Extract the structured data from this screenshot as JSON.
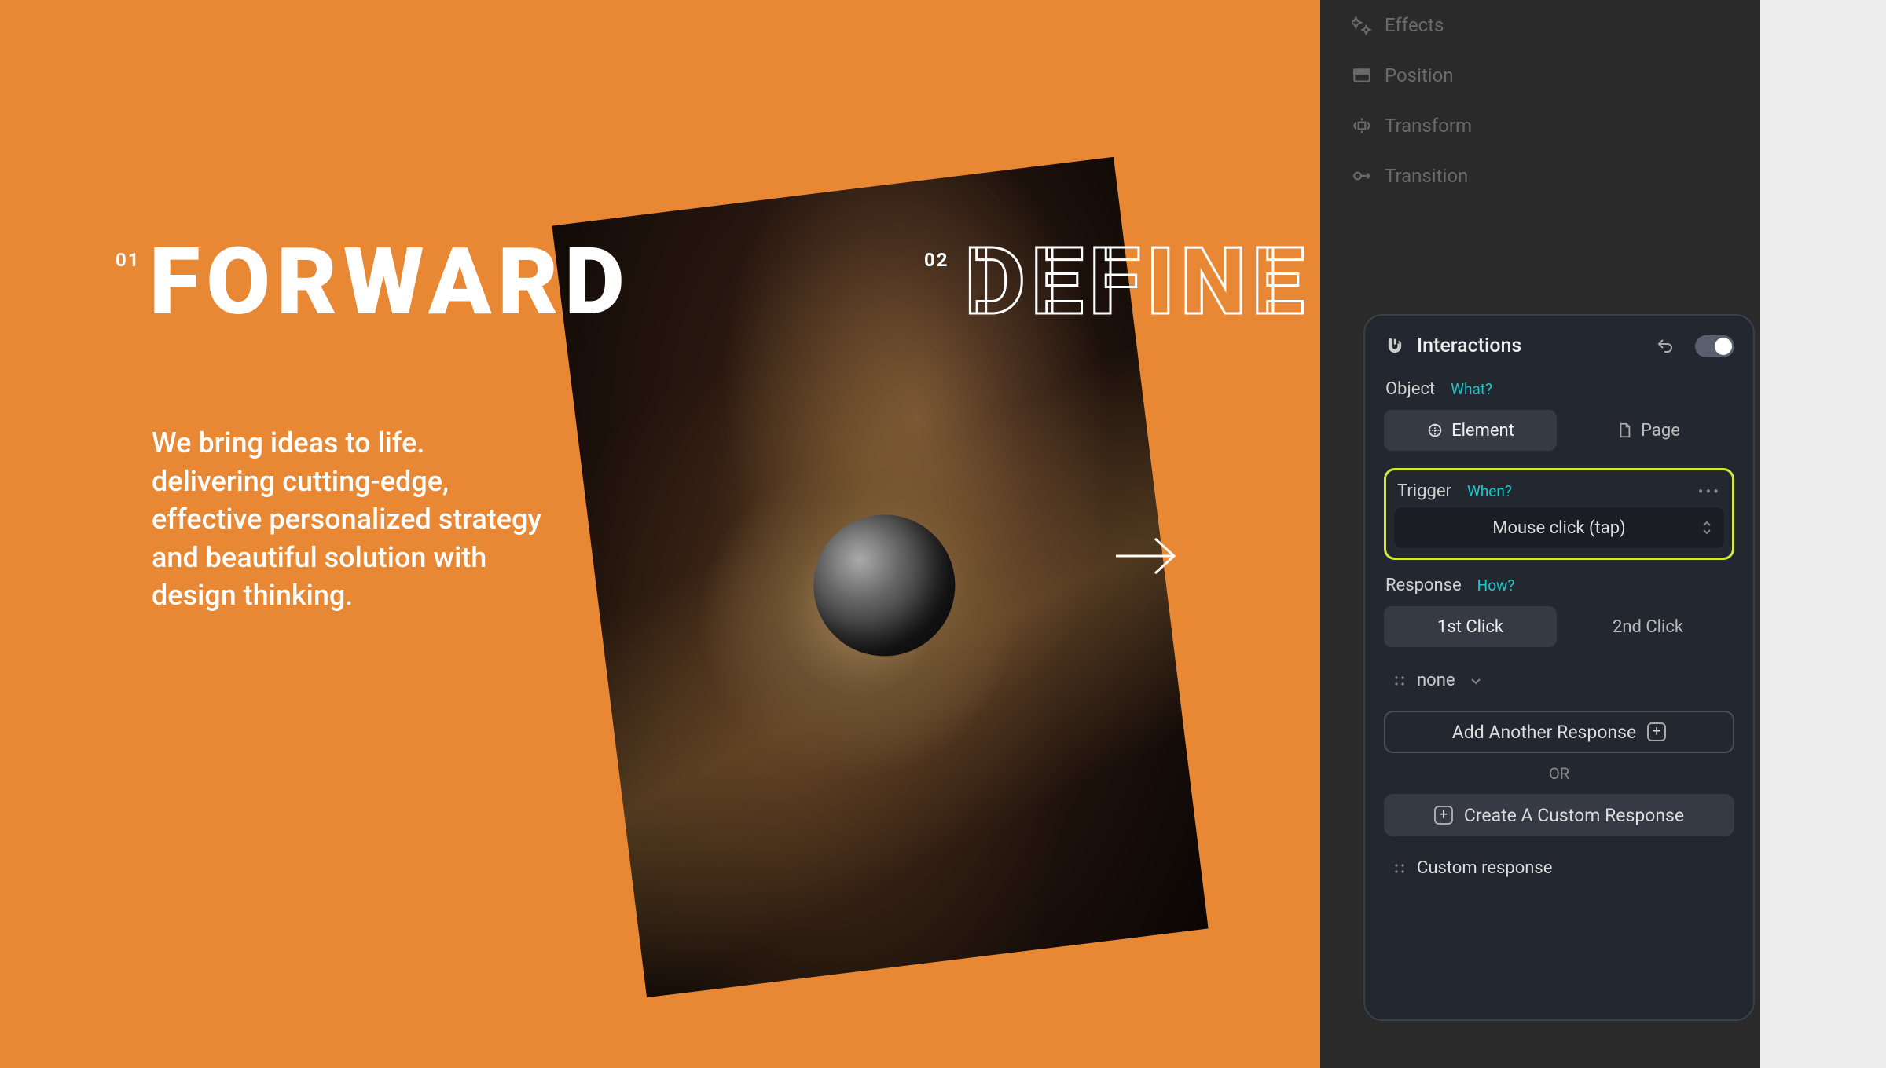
{
  "canvas": {
    "bg": "#e88834",
    "heading1_num": "01",
    "heading1_text": "FORWARD",
    "heading2_num": "02",
    "heading2_text": "DEFINE",
    "body": "We bring ideas to life. delivering cutting-edge, effective personalized strategy and beautiful solution with design thinking."
  },
  "side_properties": [
    {
      "icon": "effects",
      "label": "Effects"
    },
    {
      "icon": "position",
      "label": "Position"
    },
    {
      "icon": "transform",
      "label": "Transform"
    },
    {
      "icon": "transition",
      "label": "Transition"
    }
  ],
  "interactions": {
    "title": "Interactions",
    "object": {
      "label": "Object",
      "hint": "What?",
      "options": [
        "Element",
        "Page"
      ],
      "selected": 0
    },
    "trigger": {
      "label": "Trigger",
      "hint": "When?",
      "value": "Mouse click (tap)"
    },
    "response": {
      "label": "Response",
      "hint": "How?",
      "tabs": [
        "1st Click",
        "2nd Click"
      ],
      "selected_tab": 0,
      "preset": "none",
      "add_label": "Add Another Response",
      "or_label": "OR",
      "custom_label": "Create A Custom Response",
      "custom_row": "Custom response"
    }
  }
}
